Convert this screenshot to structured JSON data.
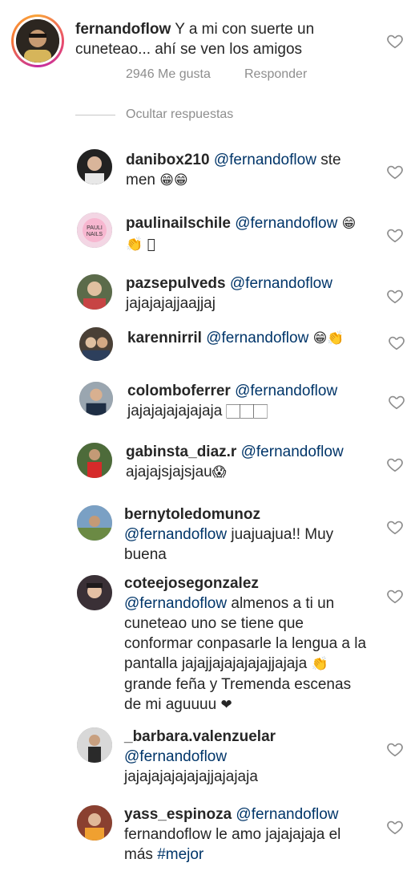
{
  "main_comment": {
    "username": "fernandoflow",
    "text": "Y a mi con suerte un cuneteao... ahí se ven los amigos",
    "likes": "2946 Me gusta",
    "reply_label": "Responder"
  },
  "hide_replies_label": "Ocultar respuestas",
  "replies": [
    {
      "username": "danibox210",
      "mention": "@fernandoflow",
      "text": "ste men",
      "emoji": "😁😁"
    },
    {
      "username": "paulinailschile",
      "mention": "@fernandoflow",
      "text": "",
      "emoji": "😁 👏 🏻"
    },
    {
      "username": "pazsepulveds",
      "mention": "@fernandoflow",
      "text": "jajajajajjaajjaj",
      "emoji": ""
    },
    {
      "username": "karennirril",
      "mention": "@fernandoflow",
      "text": "",
      "emoji": "😁👏"
    },
    {
      "username": "colomboferrer",
      "mention": "@fernandoflow",
      "text": "jajajajajajajaja",
      "emoji": "🏻🏻🏻"
    },
    {
      "username": "gabinsta_diaz.r",
      "mention": "@fernandoflow",
      "text": "ajajajsjajsjau",
      "emoji": "😱"
    },
    {
      "username": "bernytoledomunoz",
      "mention": "@fernandoflow",
      "text": "juajuajua!! Muy buena",
      "emoji": ""
    },
    {
      "username": "coteejosegonzalez",
      "mention": "@fernandoflow",
      "text": "almenos a ti un cuneteao uno se tiene que conformar conpasarle la lengua a la pantalla jajajjajajajajajjajaja",
      "text2": "grande feña y Tremenda escenas de mi aguuuu",
      "emoji": "👏",
      "emoji2": "❤"
    },
    {
      "username": "_barbara.valenzuelar",
      "mention": "@fernandoflow",
      "text": "jajajajajajajajjajajaja",
      "emoji": ""
    },
    {
      "username": "yass_espinoza",
      "mention": "@fernandoflow",
      "text": "fernandoflow le amo jajajajaja el más",
      "hashtag": "#mejor",
      "emoji": ""
    }
  ],
  "colors": {
    "text": "#262626",
    "mention": "#003569",
    "meta": "#8e8e8e"
  },
  "icons": {
    "like": "heart-outline-icon"
  }
}
